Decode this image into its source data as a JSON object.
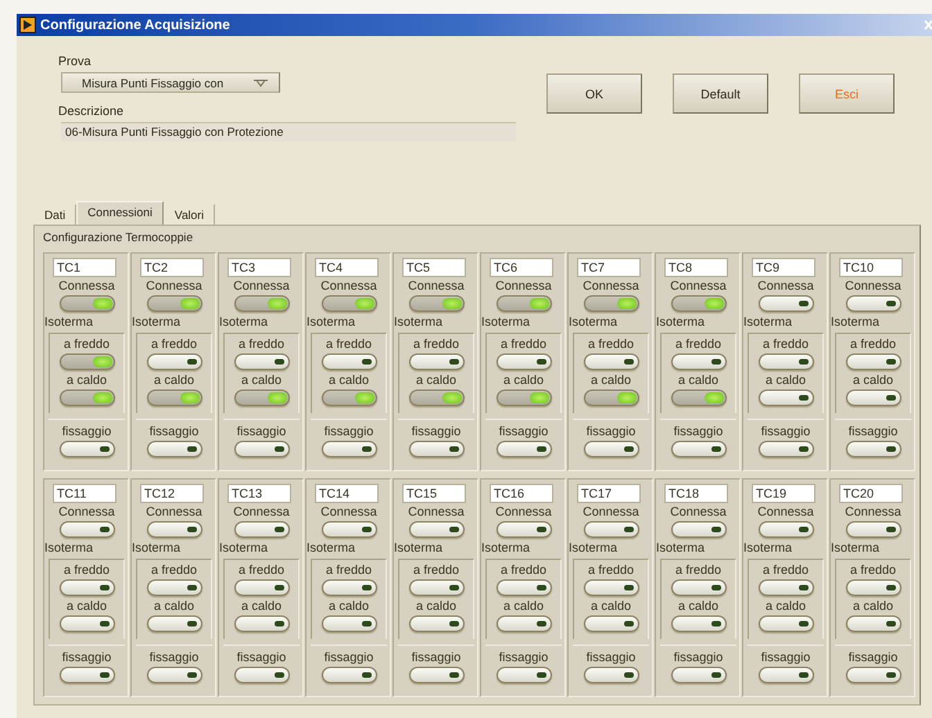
{
  "window": {
    "title": "Configurazione Acquisizione"
  },
  "prova": {
    "label": "Prova",
    "value": "Misura Punti Fissaggio con"
  },
  "descrizione": {
    "label": "Descrizione",
    "value": "06-Misura Punti Fissaggio con Protezione"
  },
  "buttons": [
    {
      "label": "OK",
      "kind": "normal"
    },
    {
      "label": "Default",
      "kind": "normal"
    },
    {
      "label": "Esci",
      "kind": "exit"
    }
  ],
  "tabs": [
    {
      "label": "Dati",
      "selected": false
    },
    {
      "label": "Connessioni",
      "selected": true
    },
    {
      "label": "Valori",
      "selected": false
    }
  ],
  "panel": {
    "title": "Configurazione Termocoppie",
    "thermocouples": [
      {
        "name": "TC1",
        "connessa": {
          "label": "Connessa",
          "on": true
        },
        "isoterma": {
          "label": "Isoterma",
          "a_freddo": {
            "label": "a freddo",
            "on": true
          },
          "a_caldo": {
            "label": "a caldo",
            "on": true
          }
        },
        "fissaggio": {
          "label": "fissaggio",
          "on": false
        }
      },
      {
        "name": "TC2",
        "connessa": {
          "label": "Connessa",
          "on": true
        },
        "isoterma": {
          "label": "Isoterma",
          "a_freddo": {
            "label": "a freddo",
            "on": false
          },
          "a_caldo": {
            "label": "a caldo",
            "on": true
          }
        },
        "fissaggio": {
          "label": "fissaggio",
          "on": false
        }
      },
      {
        "name": "TC3",
        "connessa": {
          "label": "Connessa",
          "on": true
        },
        "isoterma": {
          "label": "Isoterma",
          "a_freddo": {
            "label": "a freddo",
            "on": false
          },
          "a_caldo": {
            "label": "a caldo",
            "on": true
          }
        },
        "fissaggio": {
          "label": "fissaggio",
          "on": false
        }
      },
      {
        "name": "TC4",
        "connessa": {
          "label": "Connessa",
          "on": true
        },
        "isoterma": {
          "label": "Isoterma",
          "a_freddo": {
            "label": "a freddo",
            "on": false
          },
          "a_caldo": {
            "label": "a caldo",
            "on": true
          }
        },
        "fissaggio": {
          "label": "fissaggio",
          "on": false
        }
      },
      {
        "name": "TC5",
        "connessa": {
          "label": "Connessa",
          "on": true
        },
        "isoterma": {
          "label": "Isoterma",
          "a_freddo": {
            "label": "a freddo",
            "on": false
          },
          "a_caldo": {
            "label": "a caldo",
            "on": true
          }
        },
        "fissaggio": {
          "label": "fissaggio",
          "on": false
        }
      },
      {
        "name": "TC6",
        "connessa": {
          "label": "Connessa",
          "on": true
        },
        "isoterma": {
          "label": "Isoterma",
          "a_freddo": {
            "label": "a freddo",
            "on": false
          },
          "a_caldo": {
            "label": "a caldo",
            "on": true
          }
        },
        "fissaggio": {
          "label": "fissaggio",
          "on": false
        }
      },
      {
        "name": "TC7",
        "connessa": {
          "label": "Connessa",
          "on": true
        },
        "isoterma": {
          "label": "Isoterma",
          "a_freddo": {
            "label": "a freddo",
            "on": false
          },
          "a_caldo": {
            "label": "a caldo",
            "on": true
          }
        },
        "fissaggio": {
          "label": "fissaggio",
          "on": false
        }
      },
      {
        "name": "TC8",
        "connessa": {
          "label": "Connessa",
          "on": true
        },
        "isoterma": {
          "label": "Isoterma",
          "a_freddo": {
            "label": "a freddo",
            "on": false
          },
          "a_caldo": {
            "label": "a caldo",
            "on": true
          }
        },
        "fissaggio": {
          "label": "fissaggio",
          "on": false
        }
      },
      {
        "name": "TC9",
        "connessa": {
          "label": "Connessa",
          "on": false
        },
        "isoterma": {
          "label": "Isoterma",
          "a_freddo": {
            "label": "a freddo",
            "on": false
          },
          "a_caldo": {
            "label": "a caldo",
            "on": false
          }
        },
        "fissaggio": {
          "label": "fissaggio",
          "on": false
        }
      },
      {
        "name": "TC10",
        "connessa": {
          "label": "Connessa",
          "on": false
        },
        "isoterma": {
          "label": "Isoterma",
          "a_freddo": {
            "label": "a freddo",
            "on": false
          },
          "a_caldo": {
            "label": "a caldo",
            "on": false
          }
        },
        "fissaggio": {
          "label": "fissaggio",
          "on": false
        }
      },
      {
        "name": "TC11",
        "connessa": {
          "label": "Connessa",
          "on": false
        },
        "isoterma": {
          "label": "Isoterma",
          "a_freddo": {
            "label": "a freddo",
            "on": false
          },
          "a_caldo": {
            "label": "a caldo",
            "on": false
          }
        },
        "fissaggio": {
          "label": "fissaggio",
          "on": false
        }
      },
      {
        "name": "TC12",
        "connessa": {
          "label": "Connessa",
          "on": false
        },
        "isoterma": {
          "label": "Isoterma",
          "a_freddo": {
            "label": "a freddo",
            "on": false
          },
          "a_caldo": {
            "label": "a caldo",
            "on": false
          }
        },
        "fissaggio": {
          "label": "fissaggio",
          "on": false
        }
      },
      {
        "name": "TC13",
        "connessa": {
          "label": "Connessa",
          "on": false
        },
        "isoterma": {
          "label": "Isoterma",
          "a_freddo": {
            "label": "a freddo",
            "on": false
          },
          "a_caldo": {
            "label": "a caldo",
            "on": false
          }
        },
        "fissaggio": {
          "label": "fissaggio",
          "on": false
        }
      },
      {
        "name": "TC14",
        "connessa": {
          "label": "Connessa",
          "on": false
        },
        "isoterma": {
          "label": "Isoterma",
          "a_freddo": {
            "label": "a freddo",
            "on": false
          },
          "a_caldo": {
            "label": "a caldo",
            "on": false
          }
        },
        "fissaggio": {
          "label": "fissaggio",
          "on": false
        }
      },
      {
        "name": "TC15",
        "connessa": {
          "label": "Connessa",
          "on": false
        },
        "isoterma": {
          "label": "Isoterma",
          "a_freddo": {
            "label": "a freddo",
            "on": false
          },
          "a_caldo": {
            "label": "a caldo",
            "on": false
          }
        },
        "fissaggio": {
          "label": "fissaggio",
          "on": false
        }
      },
      {
        "name": "TC16",
        "connessa": {
          "label": "Connessa",
          "on": false
        },
        "isoterma": {
          "label": "Isoterma",
          "a_freddo": {
            "label": "a freddo",
            "on": false
          },
          "a_caldo": {
            "label": "a caldo",
            "on": false
          }
        },
        "fissaggio": {
          "label": "fissaggio",
          "on": false
        }
      },
      {
        "name": "TC17",
        "connessa": {
          "label": "Connessa",
          "on": false
        },
        "isoterma": {
          "label": "Isoterma",
          "a_freddo": {
            "label": "a freddo",
            "on": false
          },
          "a_caldo": {
            "label": "a caldo",
            "on": false
          }
        },
        "fissaggio": {
          "label": "fissaggio",
          "on": false
        }
      },
      {
        "name": "TC18",
        "connessa": {
          "label": "Connessa",
          "on": false
        },
        "isoterma": {
          "label": "Isoterma",
          "a_freddo": {
            "label": "a freddo",
            "on": false
          },
          "a_caldo": {
            "label": "a caldo",
            "on": false
          }
        },
        "fissaggio": {
          "label": "fissaggio",
          "on": false
        }
      },
      {
        "name": "TC19",
        "connessa": {
          "label": "Connessa",
          "on": false
        },
        "isoterma": {
          "label": "Isoterma",
          "a_freddo": {
            "label": "a freddo",
            "on": false
          },
          "a_caldo": {
            "label": "a caldo",
            "on": false
          }
        },
        "fissaggio": {
          "label": "fissaggio",
          "on": false
        }
      },
      {
        "name": "TC20",
        "connessa": {
          "label": "Connessa",
          "on": false
        },
        "isoterma": {
          "label": "Isoterma",
          "a_freddo": {
            "label": "a freddo",
            "on": false
          },
          "a_caldo": {
            "label": "a caldo",
            "on": false
          }
        },
        "fissaggio": {
          "label": "fissaggio",
          "on": false
        }
      }
    ]
  }
}
